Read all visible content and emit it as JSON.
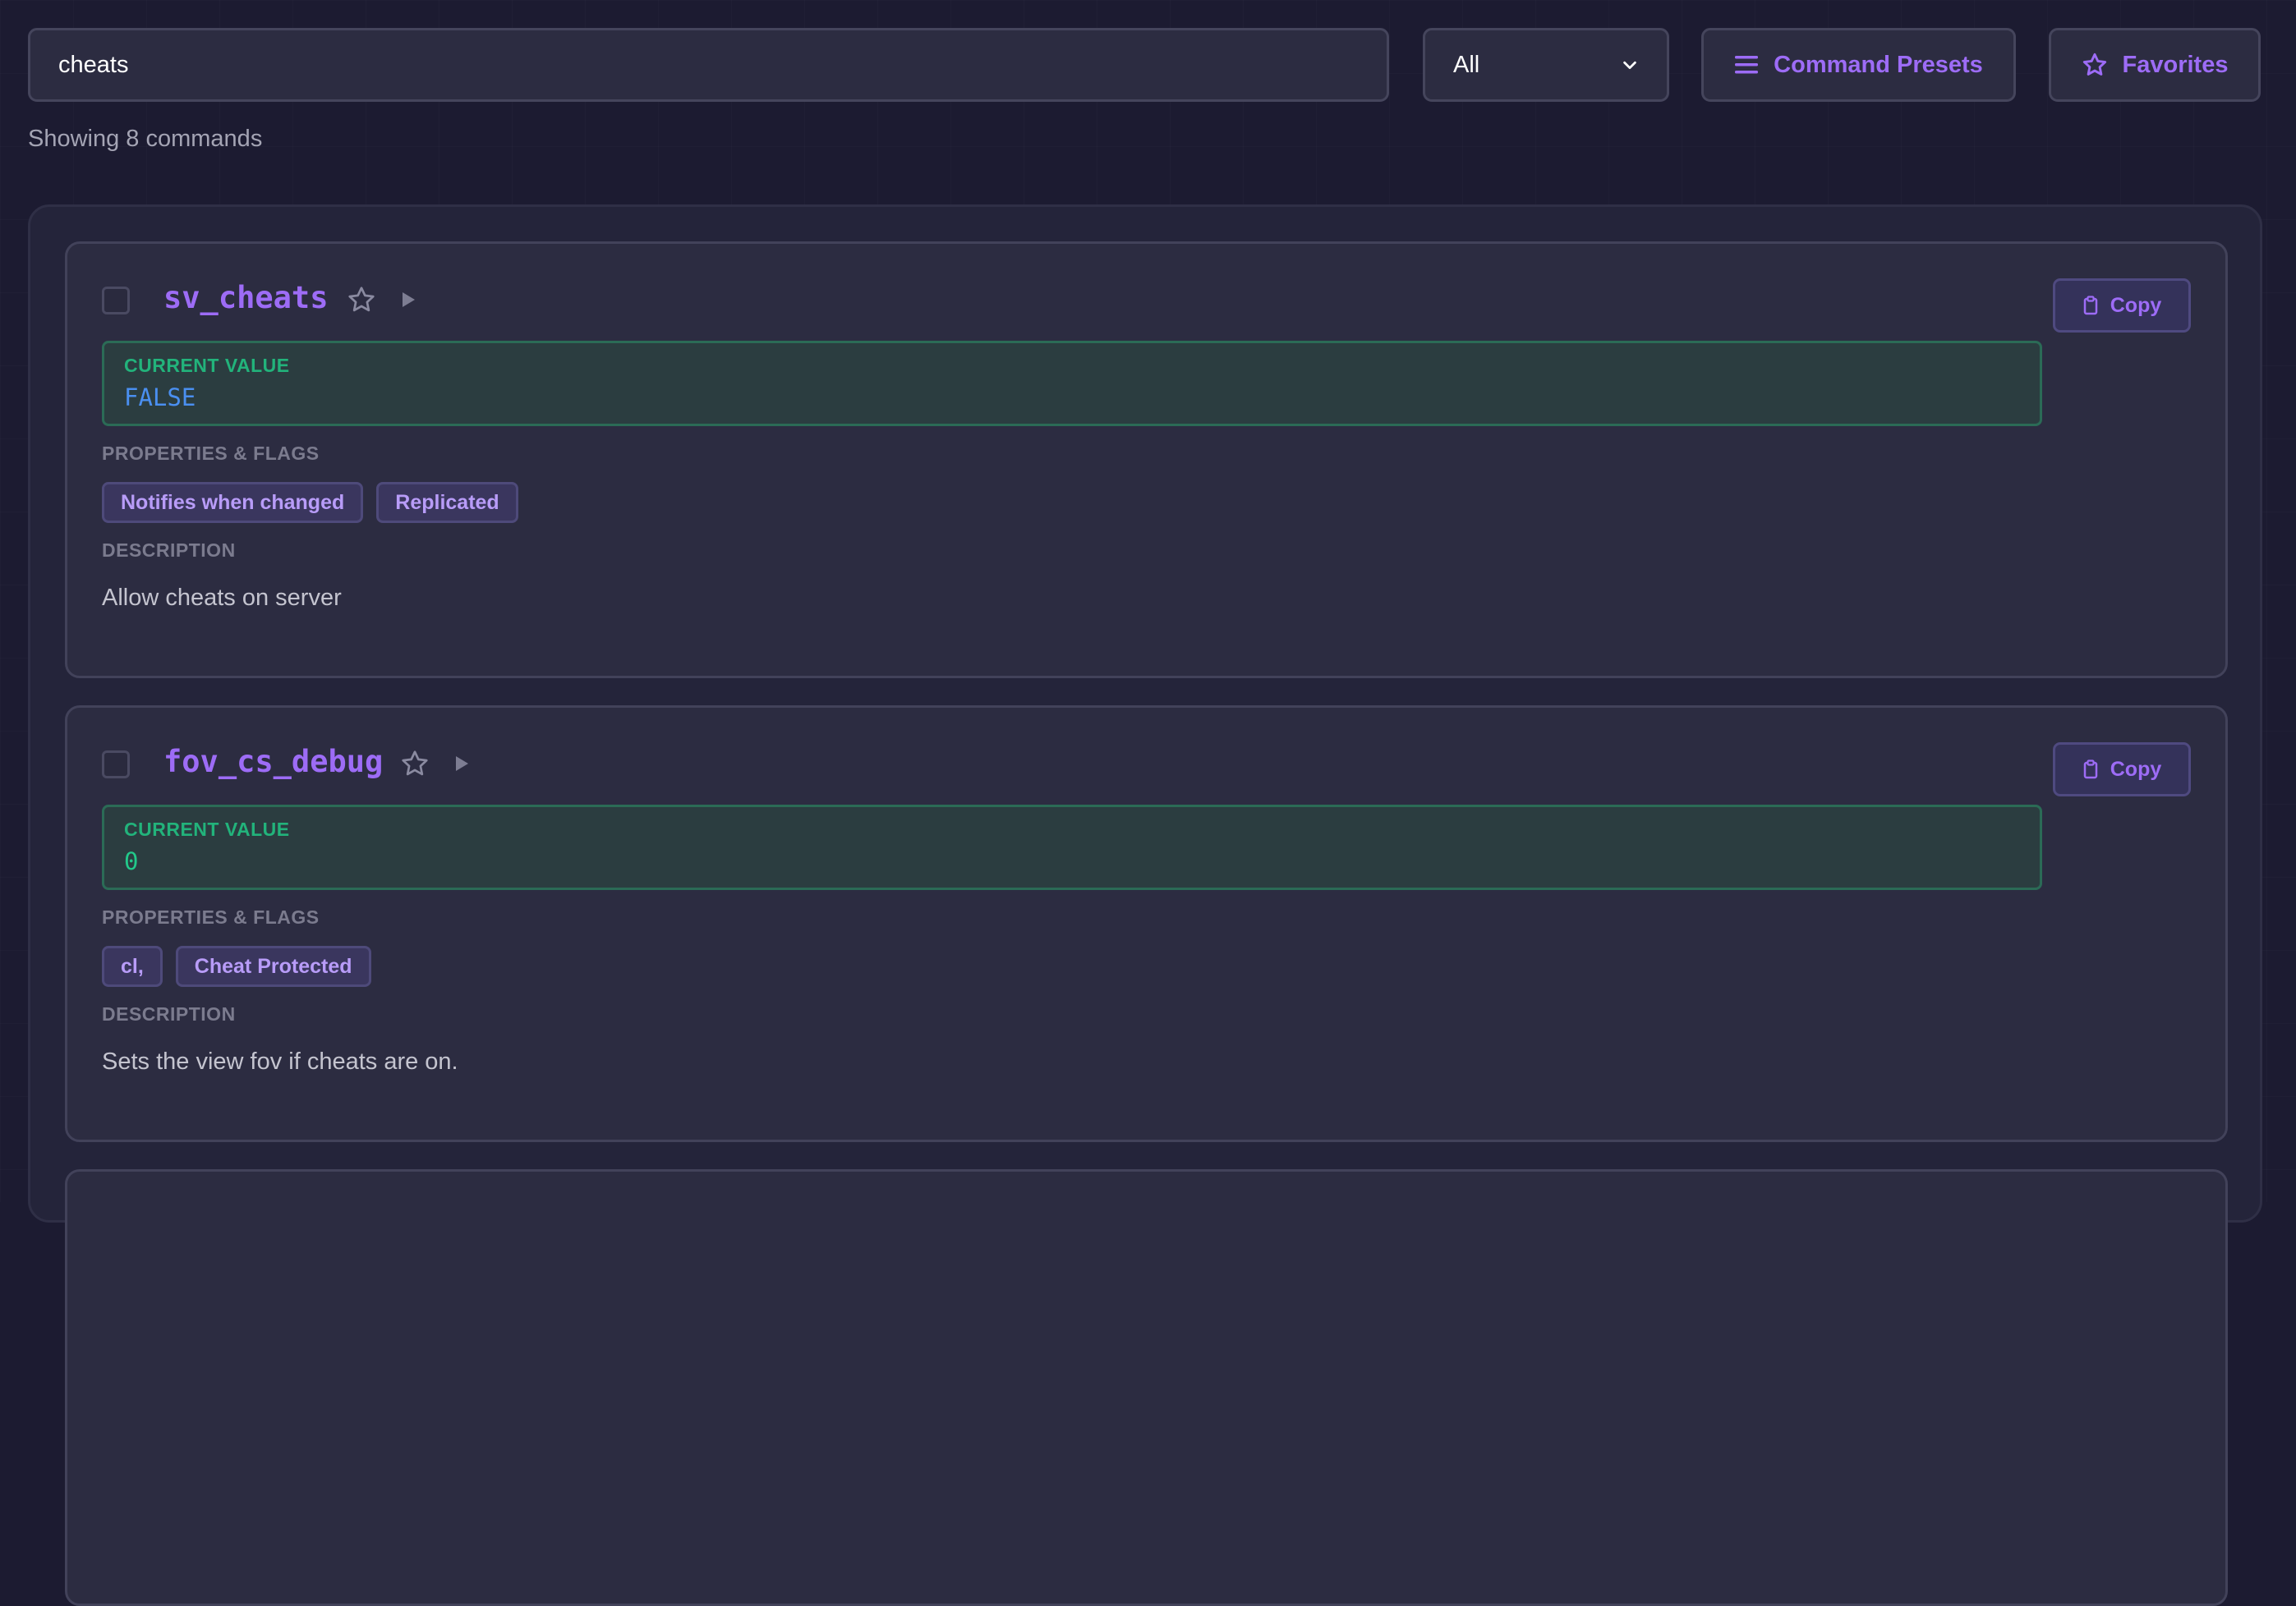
{
  "search": {
    "value": "cheats",
    "placeholder": ""
  },
  "filter": {
    "selected": "All"
  },
  "toolbar": {
    "presets_label": "Command Presets",
    "favorites_label": "Favorites"
  },
  "results": {
    "count_text": "Showing 8 commands"
  },
  "labels": {
    "current_value": "CURRENT VALUE",
    "properties": "PROPERTIES & FLAGS",
    "description": "DESCRIPTION",
    "copy": "Copy"
  },
  "colors": {
    "accent": "#9d6cf6",
    "value_false": "#4a8ff0",
    "value_number": "#22c98a"
  },
  "commands": [
    {
      "name": "sv_cheats",
      "value": "FALSE",
      "flags": [
        "Notifies when changed",
        "Replicated"
      ],
      "description": "Allow cheats on server"
    },
    {
      "name": "fov_cs_debug",
      "value": "0",
      "flags": [
        "cl,",
        "Cheat Protected"
      ],
      "description": "Sets the view fov if cheats are on."
    }
  ]
}
